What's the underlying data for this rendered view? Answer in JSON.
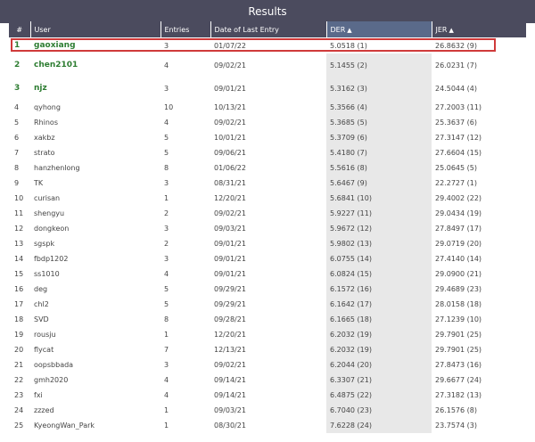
{
  "title": "Results",
  "columns": {
    "rank": "#",
    "user": "User",
    "entries": "Entries",
    "date": "Date of Last Entry",
    "der": "DER",
    "jer": "JER",
    "sort_arrow": "▲"
  },
  "rows": [
    {
      "rank": "1",
      "user": "gaoxiang",
      "entries": "3",
      "date": "01/07/22",
      "der": "5.0518 (1)",
      "jer": "26.8632 (9)"
    },
    {
      "rank": "2",
      "user": "chen2101",
      "entries": "4",
      "date": "09/02/21",
      "der": "5.1455 (2)",
      "jer": "26.0231 (7)"
    },
    {
      "rank": "3",
      "user": "njz",
      "entries": "3",
      "date": "09/01/21",
      "der": "5.3162 (3)",
      "jer": "24.5044 (4)"
    },
    {
      "rank": "4",
      "user": "qyhong",
      "entries": "10",
      "date": "10/13/21",
      "der": "5.3566 (4)",
      "jer": "27.2003 (11)"
    },
    {
      "rank": "5",
      "user": "Rhinos",
      "entries": "4",
      "date": "09/02/21",
      "der": "5.3685 (5)",
      "jer": "25.3637 (6)"
    },
    {
      "rank": "6",
      "user": "xakbz",
      "entries": "5",
      "date": "10/01/21",
      "der": "5.3709 (6)",
      "jer": "27.3147 (12)"
    },
    {
      "rank": "7",
      "user": "strato",
      "entries": "5",
      "date": "09/06/21",
      "der": "5.4180 (7)",
      "jer": "27.6604 (15)"
    },
    {
      "rank": "8",
      "user": "hanzhenlong",
      "entries": "8",
      "date": "01/06/22",
      "der": "5.5616 (8)",
      "jer": "25.0645 (5)"
    },
    {
      "rank": "9",
      "user": "TK",
      "entries": "3",
      "date": "08/31/21",
      "der": "5.6467 (9)",
      "jer": "22.2727 (1)"
    },
    {
      "rank": "10",
      "user": "curisan",
      "entries": "1",
      "date": "12/20/21",
      "der": "5.6841 (10)",
      "jer": "29.4002 (22)"
    },
    {
      "rank": "11",
      "user": "shengyu",
      "entries": "2",
      "date": "09/02/21",
      "der": "5.9227 (11)",
      "jer": "29.0434 (19)"
    },
    {
      "rank": "12",
      "user": "dongkeon",
      "entries": "3",
      "date": "09/03/21",
      "der": "5.9672 (12)",
      "jer": "27.8497 (17)"
    },
    {
      "rank": "13",
      "user": "sgspk",
      "entries": "2",
      "date": "09/01/21",
      "der": "5.9802 (13)",
      "jer": "29.0719 (20)"
    },
    {
      "rank": "14",
      "user": "fbdp1202",
      "entries": "3",
      "date": "09/01/21",
      "der": "6.0755 (14)",
      "jer": "27.4140 (14)"
    },
    {
      "rank": "15",
      "user": "ss1010",
      "entries": "4",
      "date": "09/01/21",
      "der": "6.0824 (15)",
      "jer": "29.0900 (21)"
    },
    {
      "rank": "16",
      "user": "deg",
      "entries": "5",
      "date": "09/29/21",
      "der": "6.1572 (16)",
      "jer": "29.4689 (23)"
    },
    {
      "rank": "17",
      "user": "chl2",
      "entries": "5",
      "date": "09/29/21",
      "der": "6.1642 (17)",
      "jer": "28.0158 (18)"
    },
    {
      "rank": "18",
      "user": "SVD",
      "entries": "8",
      "date": "09/28/21",
      "der": "6.1665 (18)",
      "jer": "27.1239 (10)"
    },
    {
      "rank": "19",
      "user": "rousju",
      "entries": "1",
      "date": "12/20/21",
      "der": "6.2032 (19)",
      "jer": "29.7901 (25)"
    },
    {
      "rank": "20",
      "user": "flycat",
      "entries": "7",
      "date": "12/13/21",
      "der": "6.2032 (19)",
      "jer": "29.7901 (25)"
    },
    {
      "rank": "21",
      "user": "oopsbbada",
      "entries": "3",
      "date": "09/02/21",
      "der": "6.2044 (20)",
      "jer": "27.8473 (16)"
    },
    {
      "rank": "22",
      "user": "gmh2020",
      "entries": "4",
      "date": "09/14/21",
      "der": "6.3307 (21)",
      "jer": "29.6677 (24)"
    },
    {
      "rank": "23",
      "user": "fxi",
      "entries": "4",
      "date": "09/14/21",
      "der": "6.4875 (22)",
      "jer": "27.3182 (13)"
    },
    {
      "rank": "24",
      "user": "zzzed",
      "entries": "1",
      "date": "09/03/21",
      "der": "6.7040 (23)",
      "jer": "26.1576 (8)"
    },
    {
      "rank": "25",
      "user": "KyeongWan_Park",
      "entries": "1",
      "date": "08/30/21",
      "der": "7.6228 (24)",
      "jer": "23.7574 (3)"
    }
  ],
  "colors": {
    "header_bg": "#4b4b5e",
    "top_rank_text": "#2e7d32",
    "highlight_border": "#d03a3a",
    "der_cell_bg": "#e8e8e8"
  }
}
